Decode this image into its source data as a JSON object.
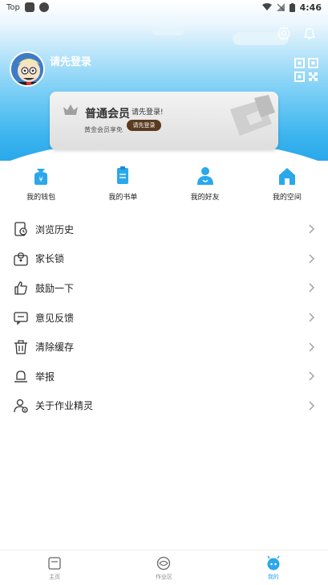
{
  "status_bar": {
    "app_label": "Top",
    "time": "4:46"
  },
  "header": {
    "login_prompt": "请先登录"
  },
  "vip": {
    "title": "普通会员",
    "subtitle": "黄金会员享免",
    "overlay_text": "请先登录!",
    "button_label": "请先登录"
  },
  "quick_actions": [
    {
      "label": "我的钱包",
      "icon": "wallet-icon"
    },
    {
      "label": "我的书单",
      "icon": "booklist-icon"
    },
    {
      "label": "我的好友",
      "icon": "friends-icon"
    },
    {
      "label": "我的空间",
      "icon": "space-icon"
    }
  ],
  "menu": [
    {
      "label": "浏览历史",
      "icon": "history-icon"
    },
    {
      "label": "家长锁",
      "icon": "parental-lock-icon"
    },
    {
      "label": "鼓励一下",
      "icon": "thumbs-up-icon"
    },
    {
      "label": "意见反馈",
      "icon": "feedback-icon"
    },
    {
      "label": "清除缓存",
      "icon": "trash-icon"
    },
    {
      "label": "举报",
      "icon": "report-bell-icon"
    },
    {
      "label": "关于作业精灵",
      "icon": "about-user-icon"
    }
  ],
  "bottom_nav": [
    {
      "label": "主页",
      "icon": "home-book-icon"
    },
    {
      "label": "作业区",
      "icon": "homework-icon"
    },
    {
      "label": "我的",
      "icon": "profile-sprite-icon"
    }
  ],
  "colors": {
    "accent": "#2aa8ea",
    "vip_button": "#5a3b1f"
  }
}
